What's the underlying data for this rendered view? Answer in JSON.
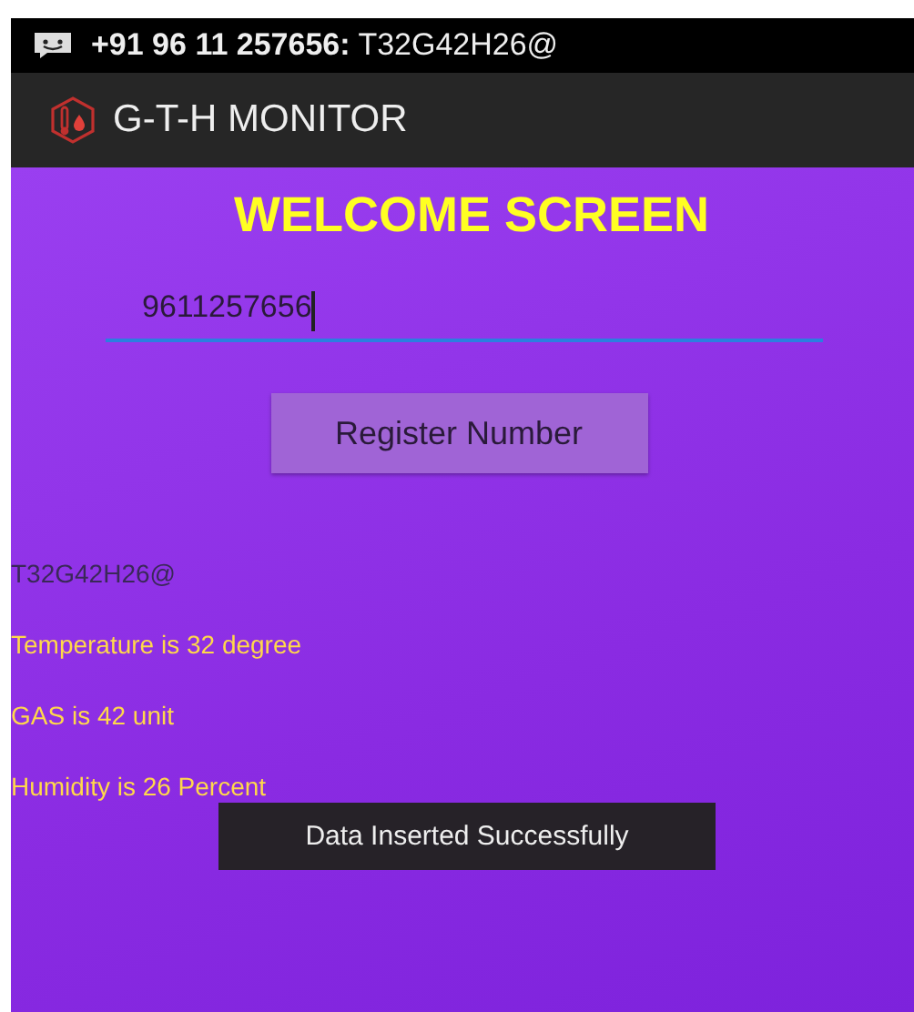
{
  "status_bar": {
    "notification": "**+91 96 11 257656:** T32G42H26@"
  },
  "app_bar": {
    "title": "G-T-H MONITOR"
  },
  "heading": "WELCOME SCREEN",
  "phone_field": {
    "value": "9611257656",
    "focused": true
  },
  "register_button": "Register Number",
  "readings": [
    {
      "kind": "raw",
      "text": "T32G42H26@"
    },
    {
      "kind": "value",
      "text": "Temperature is 32 degree"
    },
    {
      "kind": "value",
      "text": "GAS is 42 unit"
    },
    {
      "kind": "value",
      "text": "Humidity is 26 Percent"
    }
  ],
  "toast": "Data Inserted Successfully"
}
